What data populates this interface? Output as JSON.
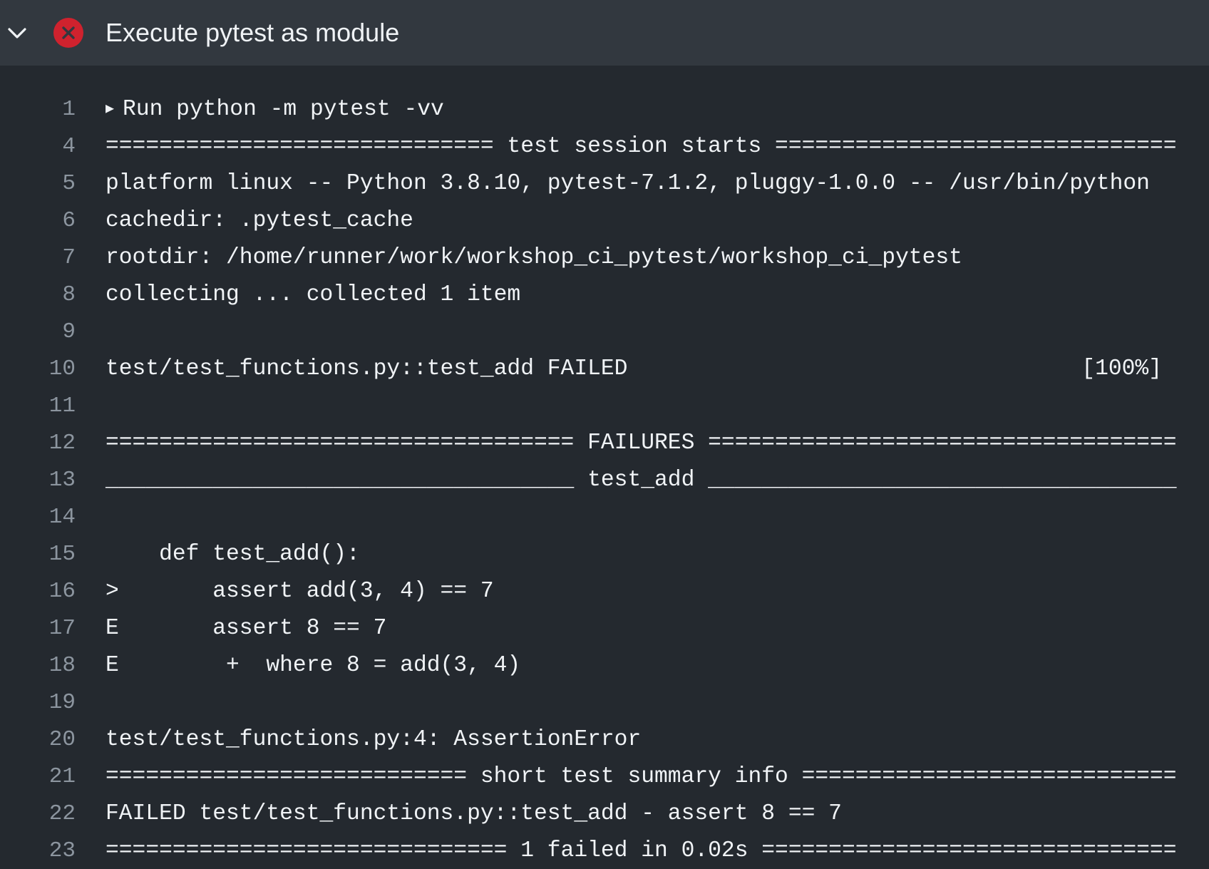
{
  "step": {
    "title": "Execute pytest as module",
    "status": "failed",
    "status_icon": "x-circle-icon",
    "status_color": "#cf222e",
    "collapse_icon": "chevron-down-icon"
  },
  "log": {
    "lines": [
      {
        "number": "1",
        "text": "Run python -m pytest -vv",
        "expandable": true
      },
      {
        "number": "4",
        "text": "============================= test session starts =============================="
      },
      {
        "number": "5",
        "text": "platform linux -- Python 3.8.10, pytest-7.1.2, pluggy-1.0.0 -- /usr/bin/python"
      },
      {
        "number": "6",
        "text": "cachedir: .pytest_cache"
      },
      {
        "number": "7",
        "text": "rootdir: /home/runner/work/workshop_ci_pytest/workshop_ci_pytest"
      },
      {
        "number": "8",
        "text": "collecting ... collected 1 item"
      },
      {
        "number": "9",
        "text": ""
      },
      {
        "number": "10",
        "text": "test/test_functions.py::test_add FAILED",
        "progress": "[100%]"
      },
      {
        "number": "11",
        "text": ""
      },
      {
        "number": "12",
        "text": "=================================== FAILURES ==================================="
      },
      {
        "number": "13",
        "text": "___________________________________ test_add ___________________________________"
      },
      {
        "number": "14",
        "text": ""
      },
      {
        "number": "15",
        "text": "    def test_add():"
      },
      {
        "number": "16",
        "text": ">       assert add(3, 4) == 7"
      },
      {
        "number": "17",
        "text": "E       assert 8 == 7"
      },
      {
        "number": "18",
        "text": "E        +  where 8 = add(3, 4)"
      },
      {
        "number": "19",
        "text": ""
      },
      {
        "number": "20",
        "text": "test/test_functions.py:4: AssertionError"
      },
      {
        "number": "21",
        "text": "=========================== short test summary info ============================"
      },
      {
        "number": "22",
        "text": "FAILED test/test_functions.py::test_add - assert 8 == 7"
      },
      {
        "number": "23",
        "text": "============================== 1 failed in 0.02s ==============================="
      }
    ]
  }
}
